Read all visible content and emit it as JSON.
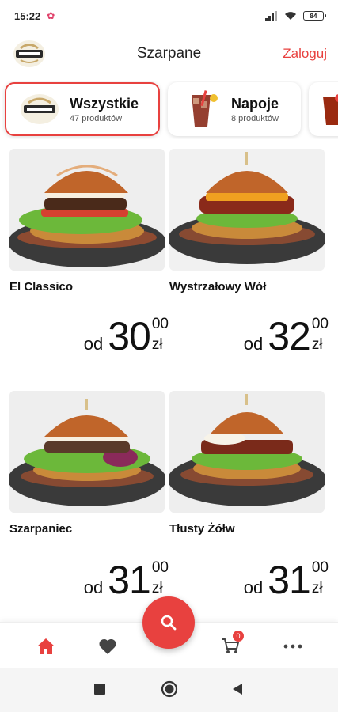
{
  "status_bar": {
    "time": "15:22",
    "battery": "84"
  },
  "header": {
    "title": "Szarpane",
    "login_label": "Zaloguj"
  },
  "categories": [
    {
      "name": "Wszystkie",
      "count": "47 produktów",
      "active": true
    },
    {
      "name": "Napoje",
      "count": "8 produktów",
      "active": false
    }
  ],
  "products": [
    {
      "name": "El Classico",
      "price_from": "od",
      "price_int": "30",
      "price_dec": "00",
      "currency": "zł"
    },
    {
      "name": "Wystrzałowy Wół",
      "price_from": "od",
      "price_int": "32",
      "price_dec": "00",
      "currency": "zł"
    },
    {
      "name": "Szarpaniec",
      "price_from": "od",
      "price_int": "31",
      "price_dec": "00",
      "currency": "zł"
    },
    {
      "name": "Tłusty Żółw",
      "price_from": "od",
      "price_int": "31",
      "price_dec": "00",
      "currency": "zł"
    }
  ],
  "bottom_nav": {
    "items": [
      "home-icon",
      "heart-icon",
      "cart-icon",
      "more-icon"
    ],
    "cart_count": "0",
    "active": "home-icon"
  },
  "fab": {
    "icon": "search-icon"
  },
  "colors": {
    "accent": "#e8413f",
    "text": "#111111",
    "muted": "#555555"
  }
}
